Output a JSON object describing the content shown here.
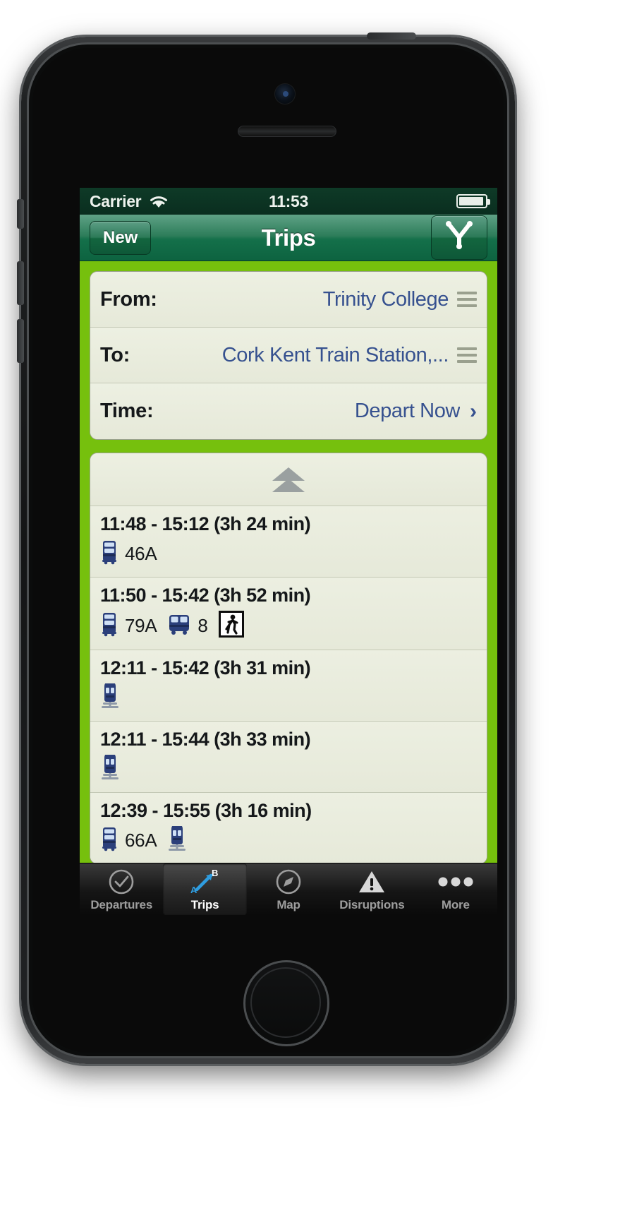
{
  "status_bar": {
    "carrier": "Carrier",
    "wifi_icon": "wifi-icon",
    "time": "11:53",
    "battery_icon": "battery-icon"
  },
  "nav_bar": {
    "left_button": "New",
    "title": "Trips",
    "right_button_icon": "route-fork-icon"
  },
  "form": {
    "rows": [
      {
        "label": "From:",
        "value": "Trinity College",
        "accessory": "reorder-icon"
      },
      {
        "label": "To:",
        "value": "Cork Kent Train Station,...",
        "accessory": "reorder-icon"
      },
      {
        "label": "Time:",
        "value": "Depart Now",
        "accessory": "chevron-right-icon"
      }
    ]
  },
  "results": {
    "load_earlier_icon": "double-chevron-up-icon",
    "trips": [
      {
        "time": "11:48 - 15:12 (3h 24 min)",
        "legs": [
          {
            "icon": "double-decker-bus-icon",
            "label": "46A"
          }
        ]
      },
      {
        "time": "11:50 - 15:42 (3h 52 min)",
        "legs": [
          {
            "icon": "double-decker-bus-icon",
            "label": "79A"
          },
          {
            "icon": "single-decker-bus-icon",
            "label": "8"
          },
          {
            "icon": "walking-person-icon",
            "label": ""
          }
        ]
      },
      {
        "time": "12:11 - 15:42 (3h 31 min)",
        "legs": [
          {
            "icon": "train-icon",
            "label": ""
          }
        ]
      },
      {
        "time": "12:11 - 15:44 (3h 33 min)",
        "legs": [
          {
            "icon": "train-icon",
            "label": ""
          }
        ]
      },
      {
        "time": "12:39 - 15:55 (3h 16 min)",
        "legs": [
          {
            "icon": "double-decker-bus-icon",
            "label": "66A"
          },
          {
            "icon": "train-icon",
            "label": ""
          }
        ]
      }
    ]
  },
  "tab_bar": {
    "items": [
      {
        "label": "Departures",
        "icon": "clock-icon",
        "selected": false
      },
      {
        "label": "Trips",
        "icon": "route-a-to-b-icon",
        "selected": true
      },
      {
        "label": "Map",
        "icon": "compass-icon",
        "selected": false
      },
      {
        "label": "Disruptions",
        "icon": "warning-triangle-icon",
        "selected": false
      },
      {
        "label": "More",
        "icon": "ellipsis-icon",
        "selected": false
      }
    ]
  },
  "colors": {
    "brand_green": "#76c00d",
    "nav_green": "#14704a",
    "link_blue": "#36518f",
    "card_bg": "#e9ecdc",
    "tab_selected": "#ffffff"
  }
}
